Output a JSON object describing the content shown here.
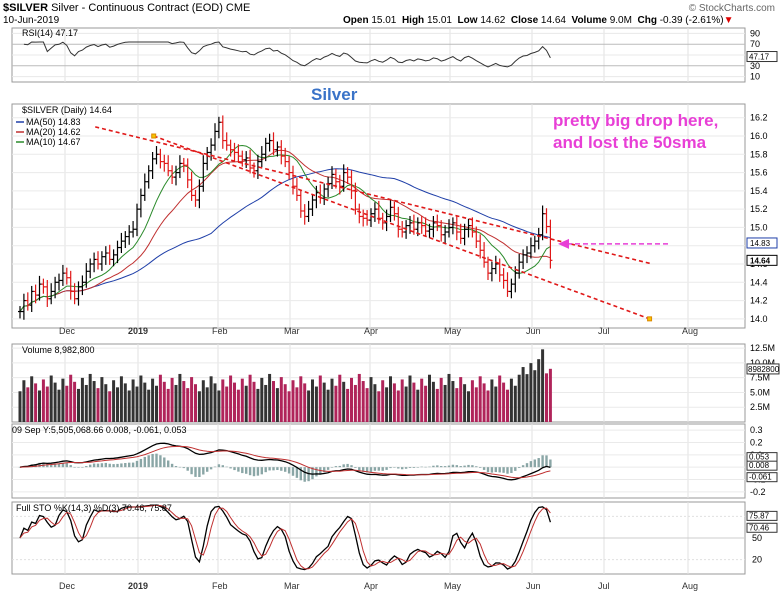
{
  "header": {
    "symbol": "$SILVER",
    "title_rest": "Silver - Continuous Contract (EOD)  CME",
    "date": "10-Jun-2019",
    "open_label": "Open",
    "open": "15.01",
    "high_label": "High",
    "high": "15.01",
    "low_label": "Low",
    "low": "14.62",
    "close_label": "Close",
    "close": "14.64",
    "volume_label": "Volume",
    "volume": "9.0M",
    "chg_label": "Chg",
    "chg": "-0.39 (-2.61%)",
    "chg_arrow": "▼",
    "watermark": "© StockCharts.com"
  },
  "rsi": {
    "label": "RSI(14) 47.17",
    "ticks": [
      "90",
      "70",
      "50",
      "30",
      "10"
    ],
    "current": "47.17"
  },
  "price": {
    "label": "$SILVER (Daily) 14.64",
    "legend": [
      {
        "text": "MA(50) 14.83",
        "color": "#1f3fa8"
      },
      {
        "text": "MA(20) 14.62",
        "color": "#c03030"
      },
      {
        "text": "MA(10) 14.67",
        "color": "#2a8a2a"
      }
    ],
    "ticks": [
      "16.2",
      "16.0",
      "15.8",
      "15.6",
      "15.4",
      "15.2",
      "15.0",
      "14.8",
      "14.6",
      "14.4",
      "14.2",
      "14.0"
    ],
    "tag_ma50": "14.83",
    "tag_close": "14.64",
    "overlay_label": "Silver",
    "annotation_line1": "pretty big drop here,",
    "annotation_line2": "and lost the 50sma"
  },
  "volume": {
    "label": "Volume 8,982,800",
    "ticks": [
      "12.5M",
      "10.0M",
      "7.5M",
      "5.0M",
      "2.5M"
    ],
    "tag": "8982800"
  },
  "macd": {
    "label": "09 Sep Y:5,505,068.66 0.008, -0.061, 0.053",
    "ticks": [
      "0.3",
      "0.2",
      "0.1",
      "0.0",
      "-0.1",
      "-0.2"
    ],
    "tags": [
      "0.053",
      "0.008",
      "-0.061"
    ]
  },
  "sto": {
    "label": "Full STO %K(14,3) %D(3) 70.46, 75.87",
    "ticks": [
      "80",
      "50",
      "20"
    ],
    "tags": [
      "75.87",
      "70.46"
    ]
  },
  "months": [
    "Dec",
    "2019",
    "Feb",
    "Mar",
    "Apr",
    "May",
    "Jun",
    "Jul",
    "Aug"
  ],
  "chart_data": {
    "type": "ohlc",
    "title": "$SILVER Silver - Continuous Contract (EOD) CME",
    "ylim": [
      13.9,
      16.35
    ],
    "dates_approx": "2018-11-13 to 2019-06-10, daily",
    "closes": [
      14.08,
      14.2,
      14.15,
      14.3,
      14.26,
      14.38,
      14.35,
      14.22,
      14.3,
      14.4,
      14.42,
      14.5,
      14.45,
      14.3,
      14.22,
      14.35,
      14.4,
      14.52,
      14.6,
      14.65,
      14.6,
      14.68,
      14.72,
      14.65,
      14.7,
      14.78,
      14.85,
      14.9,
      14.95,
      14.98,
      15.2,
      15.35,
      15.5,
      15.62,
      15.75,
      15.8,
      15.72,
      15.7,
      15.62,
      15.55,
      15.6,
      15.7,
      15.68,
      15.52,
      15.35,
      15.3,
      15.45,
      15.7,
      15.82,
      15.9,
      16.05,
      16.15,
      15.95,
      15.9,
      15.85,
      15.82,
      15.78,
      15.74,
      15.76,
      15.65,
      15.62,
      15.72,
      15.8,
      15.92,
      15.95,
      15.85,
      15.88,
      15.78,
      15.72,
      15.6,
      15.45,
      15.35,
      15.18,
      15.12,
      15.2,
      15.3,
      15.38,
      15.32,
      15.42,
      15.48,
      15.58,
      15.5,
      15.45,
      15.6,
      15.55,
      15.4,
      15.2,
      15.12,
      15.1,
      15.08,
      15.15,
      15.2,
      15.1,
      15.05,
      15.12,
      15.22,
      15.15,
      14.98,
      14.95,
      15.02,
      15.05,
      14.98,
      15.05,
      15.02,
      14.96,
      14.98,
      15.05,
      15.02,
      14.92,
      14.95,
      15.0,
      15.05,
      14.95,
      14.88,
      14.98,
      15.02,
      14.95,
      14.85,
      14.75,
      14.62,
      14.5,
      14.55,
      14.6,
      14.48,
      14.42,
      14.3,
      14.38,
      14.5,
      14.62,
      14.7,
      14.72,
      14.8,
      14.85,
      14.92,
      15.15,
      15.01,
      14.64
    ],
    "series": [
      {
        "name": "MA(50)",
        "last": 14.83
      },
      {
        "name": "MA(20)",
        "last": 14.62
      },
      {
        "name": "MA(10)",
        "last": 14.67
      }
    ],
    "channel_upper": [
      {
        "x": "2018-12-10",
        "y": 16.1
      },
      {
        "x": "2019-06-28",
        "y": 14.6
      }
    ],
    "channel_lower": [
      {
        "x": "2018-12-31",
        "y": 16.0
      },
      {
        "x": "2019-06-27",
        "y": 14.0
      }
    ],
    "annotation_arrow_y": 14.82,
    "colors": {
      "up": "#000000",
      "down": "#e01818",
      "ma50": "#1f3fa8",
      "ma20": "#c03030",
      "ma10": "#2a8a2a",
      "trend": "#e01818",
      "volume_up": "#333333",
      "volume_down": "#b0245a",
      "macd_hist": "#8aa6a6",
      "annot": "#e83fd6"
    }
  }
}
